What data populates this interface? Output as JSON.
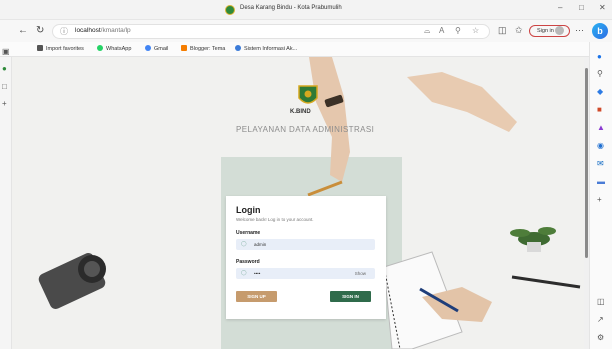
{
  "browser": {
    "tab_title": "Desa Karang Bindu - Kota Prabumulih",
    "url_host": "localhost",
    "url_path": "/kmanta/lp",
    "signin_label": "Sign in",
    "favorites": [
      {
        "label": "Import favorites",
        "icon": "folder-icon",
        "color": "#555555"
      },
      {
        "label": "WhatsApp",
        "icon": "whatsapp-icon",
        "color": "#25d366"
      },
      {
        "label": "Gmail",
        "icon": "google-icon",
        "color": "#4285f4"
      },
      {
        "label": "Blogger: Tema",
        "icon": "blogger-icon",
        "color": "#f57d00"
      },
      {
        "label": "Sistem Informasi Ak...",
        "icon": "globe-icon",
        "color": "#3b7bd8"
      }
    ]
  },
  "page": {
    "logo_text": "K.BIND",
    "headline": "PELAYANAN DATA ADMINISTRASI"
  },
  "login": {
    "title": "Login",
    "subtitle": "Welcome back! Log in to your account.",
    "username_label": "Username",
    "username_value": "admin",
    "password_label": "Password",
    "password_value": "••••",
    "show_label": "Show",
    "signup_label": "SIGN UP",
    "signin_label": "SIGN IN"
  },
  "colors": {
    "signup": "#c69b6d",
    "signin": "#2f6b4b",
    "band": "#d3ddd6"
  }
}
